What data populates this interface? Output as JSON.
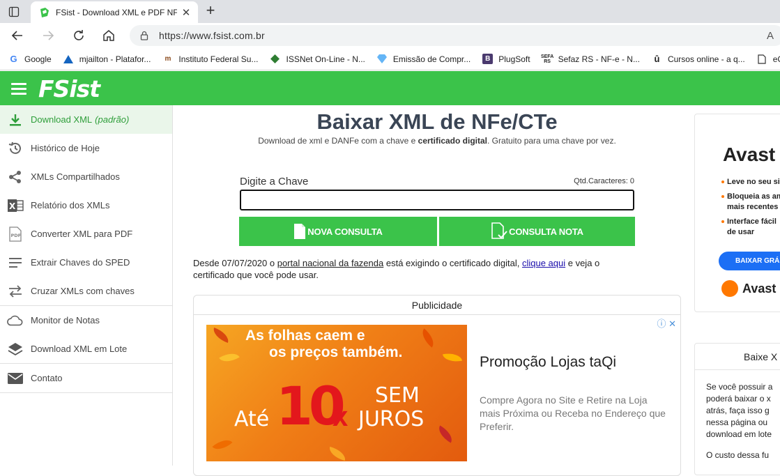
{
  "browser": {
    "tab_title": "FSist - Download XML e PDF NFe",
    "url": "https://www.fsist.com.br",
    "reader_mode": "A"
  },
  "bookmarks": [
    {
      "label": "Google",
      "icon": "google-icon"
    },
    {
      "label": "mjailton - Platafor...",
      "icon": "triangle-icon"
    },
    {
      "label": "Instituto Federal Su...",
      "icon": "ifsul-icon"
    },
    {
      "label": "ISSNet On-Line - N...",
      "icon": "diamond-icon"
    },
    {
      "label": "Emissão de Compr...",
      "icon": "gem-icon"
    },
    {
      "label": "PlugSoft",
      "icon": "b-icon"
    },
    {
      "label": "Sefaz RS - NF-e - N...",
      "icon": "sefaz-icon"
    },
    {
      "label": "Cursos online - a q...",
      "icon": "u-icon"
    },
    {
      "label": "eCAC",
      "icon": "page-icon"
    }
  ],
  "site": {
    "logo": "FSist",
    "brand_color": "#3bc34a"
  },
  "sidebar": {
    "items": [
      {
        "label": "Download XML",
        "suffix": "(padrão)",
        "icon": "download-icon"
      },
      {
        "label": "Histórico de Hoje",
        "icon": "history-icon"
      },
      {
        "label": "XMLs Compartilhados",
        "icon": "share-icon"
      },
      {
        "label": "Relatório dos XMLs",
        "icon": "excel-icon"
      },
      {
        "label": "Converter XML para PDF",
        "icon": "pdf-icon"
      },
      {
        "label": "Extrair Chaves do SPED",
        "icon": "lines-icon"
      },
      {
        "label": "Cruzar XMLs com chaves",
        "icon": "swap-icon"
      },
      {
        "label": "Monitor de Notas",
        "icon": "cloud-icon"
      },
      {
        "label": "Download XML em Lote",
        "icon": "layers-icon"
      },
      {
        "label": "Contato",
        "icon": "mail-icon"
      }
    ]
  },
  "main": {
    "title": "Baixar XML de NFe/CTe",
    "subtitle_pre": "Download de xml e DANFe com a chave e ",
    "subtitle_bold": "certificado digital",
    "subtitle_post": ". Gratuito para uma chave por vez.",
    "chave_label": "Digite a Chave",
    "qtd_label": "Qtd.Caracteres: 0",
    "chave_value": "",
    "btn_nova": "NOVA CONSULTA",
    "btn_nota": "CONSULTA NOTA",
    "notice_1": "Desde 07/07/2020 o ",
    "notice_link1": "portal nacional da fazenda",
    "notice_2": " está exigindo o certificado digital, ",
    "notice_link2": "clique aqui",
    "notice_3": " e veja o certificado que você pode usar."
  },
  "ad": {
    "section_title": "Publicidade",
    "img_line1": "As folhas caem e",
    "img_line2": "os preços também.",
    "img_ate": "Até",
    "img_10": "10",
    "img_x": "x",
    "img_sem": "SEM",
    "img_juros": "JUROS",
    "info": "ⓘ ✕",
    "headline": "Promoção Lojas taQi",
    "description": "Compre Agora no Site e Retire na Loja mais Próxima ou Receba no Endereço que Preferir."
  },
  "right_ad": {
    "title": "Avast F",
    "bullets": [
      "Leve no seu sis",
      "Bloqueia as am",
      "mais recentes",
      "Interface fácil",
      "de usar"
    ],
    "button": "BAIXAR GRÁ",
    "logo": "Avast"
  },
  "right_box": {
    "title": "Baixe X",
    "lines": [
      "Se você possuir a",
      "poderá baixar o x",
      "atrás, faça isso g",
      "nessa página ou",
      "download em lote",
      "",
      "O custo dessa fu"
    ]
  }
}
